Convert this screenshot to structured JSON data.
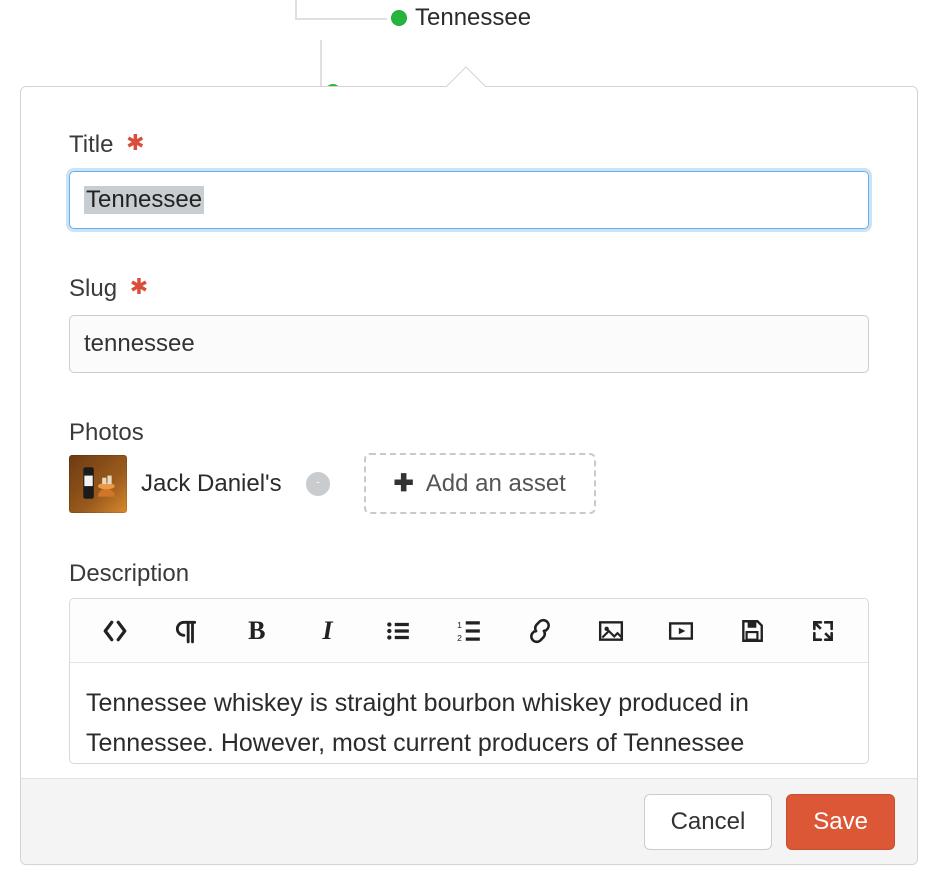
{
  "tree": {
    "node_label": "Tennessee"
  },
  "form": {
    "title": {
      "label": "Title",
      "required_marker": "✱",
      "value": "Tennessee"
    },
    "slug": {
      "label": "Slug",
      "required_marker": "✱",
      "value": "tennessee"
    },
    "photos": {
      "label": "Photos",
      "asset_name": "Jack Daniel's",
      "add_label": "Add an asset"
    },
    "description": {
      "label": "Description",
      "content": "Tennessee whiskey is straight bourbon whiskey produced in Tennessee. However, most current producers of Tennessee"
    }
  },
  "toolbar": {
    "code": "code-icon",
    "paragraph": "paragraph-icon",
    "bold": "B",
    "italic": "I",
    "ul": "list-icon",
    "ol": "ordered-list-icon",
    "link": "link-icon",
    "image": "image-icon",
    "video": "video-icon",
    "save": "save-icon",
    "fullscreen": "fullscreen-icon"
  },
  "footer": {
    "cancel": "Cancel",
    "save": "Save"
  }
}
